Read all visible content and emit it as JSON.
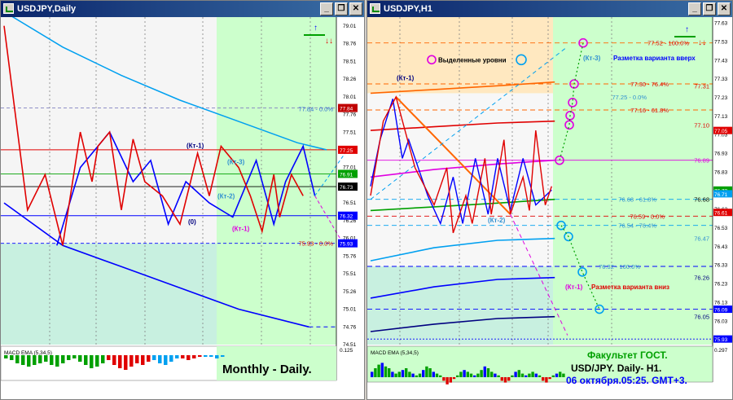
{
  "windows": {
    "left": {
      "title": "USDJPY,Daily"
    },
    "right": {
      "title": "USDJPY,H1"
    }
  },
  "window_buttons": {
    "minimize": "_",
    "restore": "❐",
    "close": "✕"
  },
  "colors": {
    "grid": "#808080",
    "red": "#e00000",
    "blue": "#0000ff",
    "darkblue": "#000080",
    "cyan": "#00a0f0",
    "magenta": "#e000e0",
    "green": "#00a000",
    "orange": "#ff6600",
    "chart_bg": "#ffffff",
    "zone_green": "#ccffcc",
    "zone_teal": "#c8f0e0",
    "zone_tan": "#ffe8c0"
  },
  "chart_data": [
    {
      "type": "line",
      "panel": "USDJPY,Daily",
      "y_axis_ticks": [
        "79.01",
        "78.76",
        "78.51",
        "78.26",
        "78.01",
        "77.76",
        "77.51",
        "77.26",
        "77.01",
        "76.76",
        "76.51",
        "76.26",
        "76.01",
        "75.76",
        "75.51",
        "75.26",
        "75.01",
        "74.76",
        "74.51"
      ],
      "ylim": [
        74.5,
        79.1
      ],
      "price_labels": [
        "77.84",
        "77.25",
        "76.91",
        "76.73",
        "76.32",
        "75.93"
      ],
      "levels": [
        {
          "label": "77.84 - 0.0%",
          "value": 77.84
        },
        {
          "label": "75.93 - 0.0%",
          "value": 75.93
        }
      ],
      "horizontal_lines": [
        77.25,
        76.91,
        76.73,
        76.32,
        75.93
      ],
      "zigzag_red": [
        [
          0,
          79.0
        ],
        [
          4,
          76.4
        ],
        [
          7,
          76.9
        ],
        [
          10,
          75.9
        ],
        [
          13,
          77.5
        ],
        [
          15,
          76.8
        ],
        [
          16,
          77.3
        ],
        [
          18,
          77.5
        ],
        [
          20,
          76.4
        ],
        [
          22,
          77.4
        ],
        [
          24,
          76.8
        ],
        [
          27,
          76.6
        ],
        [
          30,
          76.2
        ],
        [
          33,
          77.2
        ],
        [
          35,
          76.6
        ],
        [
          37,
          77.3
        ],
        [
          40,
          77.0
        ],
        [
          42,
          76.6
        ],
        [
          44,
          76.1
        ],
        [
          46,
          76.9
        ],
        [
          47,
          76.3
        ],
        [
          49,
          76.9
        ],
        [
          51,
          76.6
        ]
      ],
      "zigzag_blue": [
        [
          9,
          75.9
        ],
        [
          13,
          77.0
        ],
        [
          18,
          77.5
        ],
        [
          22,
          76.8
        ],
        [
          25,
          77.1
        ],
        [
          28,
          76.2
        ],
        [
          31,
          76.8
        ],
        [
          35,
          76.5
        ],
        [
          39,
          76.3
        ],
        [
          43,
          77.1
        ],
        [
          46,
          76.2
        ],
        [
          48,
          76.8
        ],
        [
          51,
          77.3
        ],
        [
          53,
          76.6
        ]
      ],
      "ma_cyan": [
        [
          0,
          79.2
        ],
        [
          10,
          78.7
        ],
        [
          20,
          78.3
        ],
        [
          30,
          77.95
        ],
        [
          40,
          77.65
        ],
        [
          50,
          77.35
        ],
        [
          55,
          77.25
        ]
      ],
      "trend_blue": [
        [
          0,
          76.5
        ],
        [
          10,
          75.9
        ],
        [
          20,
          75.6
        ],
        [
          30,
          75.3
        ],
        [
          40,
          75.0
        ],
        [
          52,
          74.75
        ]
      ],
      "annotations": [
        "(Кт-1)",
        "(Кт-3)",
        "(Кт-2)",
        "(0)",
        "(Кт-1)"
      ],
      "indicator": {
        "name": "MACD EMA (5,34,5)",
        "value_label": "0.125",
        "histogram": [
          0.2,
          0.3,
          0.5,
          0.6,
          0.7,
          0.6,
          0.5,
          0.4,
          0.6,
          0.7,
          0.5,
          0.3,
          0.2,
          0.4,
          0.6,
          0.8,
          0.7,
          0.5,
          -0.3,
          -0.6,
          -0.8,
          -0.9,
          -0.7,
          -0.5,
          -0.6,
          -0.4,
          0.3,
          0.5,
          0.6,
          0.4,
          0.2,
          -0.2,
          -0.3,
          -0.2,
          -0.1,
          0.1,
          0.1,
          0.2,
          0.1
        ]
      },
      "caption": "Monthly - Daily."
    },
    {
      "type": "line",
      "panel": "USDJPY,H1",
      "y_axis_ticks": [
        "77.63",
        "77.53",
        "77.43",
        "77.33",
        "77.23",
        "77.13",
        "77.03",
        "76.93",
        "76.83",
        "76.73",
        "76.63",
        "76.53",
        "76.43",
        "76.33",
        "76.23",
        "76.13",
        "76.03",
        "75.93"
      ],
      "ylim": [
        75.9,
        77.65
      ],
      "price_labels": [
        "77.05",
        "76.73",
        "76.71",
        "76.61",
        "76.09",
        "75.93"
      ],
      "levels": [
        {
          "label": "77.52 - 100.0%",
          "value": 77.52
        },
        {
          "label": "77.30 - 76.4%",
          "value": 77.3
        },
        {
          "label": "77.31",
          "value": 77.31
        },
        {
          "label": "77.25 - 0.0%",
          "value": 77.25
        },
        {
          "label": "77.16 - 61.8%",
          "value": 77.16
        },
        {
          "label": "77.10",
          "value": 77.1
        },
        {
          "label": "76.89",
          "value": 76.89
        },
        {
          "label": "76.68 - 61.8%",
          "value": 76.68
        },
        {
          "label": "76.68",
          "value": 76.68
        },
        {
          "label": "76.59 - 0.0%",
          "value": 76.59
        },
        {
          "label": "76.54 - 76.4%",
          "value": 76.54
        },
        {
          "label": "76.47",
          "value": 76.47
        },
        {
          "label": "76.32 - 100.0%",
          "value": 76.32
        },
        {
          "label": "76.26",
          "value": 76.26
        },
        {
          "label": "76.05",
          "value": 76.05
        }
      ],
      "zigzag_red": [
        [
          0,
          76.7
        ],
        [
          4,
          77.1
        ],
        [
          8,
          77.23
        ],
        [
          14,
          76.85
        ],
        [
          20,
          76.65
        ],
        [
          24,
          76.85
        ],
        [
          26,
          76.5
        ],
        [
          30,
          76.7
        ],
        [
          32,
          76.55
        ],
        [
          36,
          76.9
        ],
        [
          38,
          76.6
        ],
        [
          42,
          77.0
        ],
        [
          44,
          76.6
        ],
        [
          48,
          76.8
        ],
        [
          50,
          76.62
        ],
        [
          52,
          77.05
        ],
        [
          55,
          76.65
        ],
        [
          57,
          76.75
        ]
      ],
      "zigzag_blue": [
        [
          0,
          76.75
        ],
        [
          3,
          77.0
        ],
        [
          7,
          77.22
        ],
        [
          10,
          76.9
        ],
        [
          12,
          77.0
        ],
        [
          18,
          76.7
        ],
        [
          22,
          76.55
        ],
        [
          26,
          76.8
        ],
        [
          29,
          76.55
        ],
        [
          33,
          76.9
        ],
        [
          37,
          76.6
        ],
        [
          40,
          76.9
        ],
        [
          44,
          76.62
        ],
        [
          48,
          76.9
        ],
        [
          52,
          76.65
        ],
        [
          57,
          76.73
        ]
      ],
      "ma_orange": [
        [
          0,
          77.25
        ],
        [
          20,
          77.27
        ],
        [
          40,
          77.29
        ],
        [
          58,
          77.31
        ]
      ],
      "ma_red": [
        [
          0,
          77.05
        ],
        [
          20,
          77.07
        ],
        [
          40,
          77.09
        ],
        [
          58,
          77.1
        ]
      ],
      "ma_magenta": [
        [
          0,
          76.8
        ],
        [
          20,
          76.84
        ],
        [
          40,
          76.87
        ],
        [
          58,
          76.89
        ]
      ],
      "ma_green": [
        [
          0,
          76.62
        ],
        [
          20,
          76.64
        ],
        [
          40,
          76.66
        ],
        [
          58,
          76.68
        ]
      ],
      "ma_cyan": [
        [
          0,
          76.35
        ],
        [
          20,
          76.42
        ],
        [
          40,
          76.46
        ],
        [
          58,
          76.47
        ]
      ],
      "ma_blue": [
        [
          0,
          76.15
        ],
        [
          20,
          76.21
        ],
        [
          40,
          76.25
        ],
        [
          58,
          76.26
        ]
      ],
      "ma_darkblue": [
        [
          0,
          75.97
        ],
        [
          20,
          76.01
        ],
        [
          40,
          76.04
        ],
        [
          58,
          76.05
        ]
      ],
      "circle_levels": [
        77.52,
        77.3,
        77.2,
        77.13,
        77.08,
        76.89,
        76.54,
        76.48,
        76.29,
        76.09
      ],
      "annotations": [
        "(Кт-1)",
        "Выделенные уровни",
        "(Кт-3)",
        "Разметка варианта вверх",
        "(Кт-2)",
        "(Кт-1)",
        "Разметка варианта вниз"
      ],
      "indicator": {
        "name": "MACD EMA (5,34,5)",
        "value_label": "0.297",
        "histogram": [
          0.3,
          0.5,
          0.7,
          0.8,
          0.6,
          0.5,
          0.3,
          0.2,
          0.3,
          0.4,
          0.5,
          0.3,
          0.2,
          0.1,
          0.2,
          0.4,
          0.6,
          0.5,
          0.3,
          0.2,
          0.1,
          -0.2,
          -0.4,
          -0.3,
          -0.1,
          0.1,
          0.3,
          0.4,
          0.3,
          0.2,
          0.1,
          0.2,
          0.4,
          0.6,
          0.5,
          0.3,
          0.2,
          0.1,
          -0.2,
          -0.3,
          -0.2,
          0.1,
          0.3,
          0.4,
          0.2,
          0.1,
          0.2,
          0.3,
          0.2,
          0.1,
          -0.2,
          -0.3,
          -0.1,
          0.1,
          0.2,
          0.3,
          0.2
        ]
      },
      "caption_lines": [
        "Факультет ГОСТ.",
        "USD/JPY. Daily- H1.",
        "06 октября.05:25. GMT+3."
      ]
    }
  ]
}
